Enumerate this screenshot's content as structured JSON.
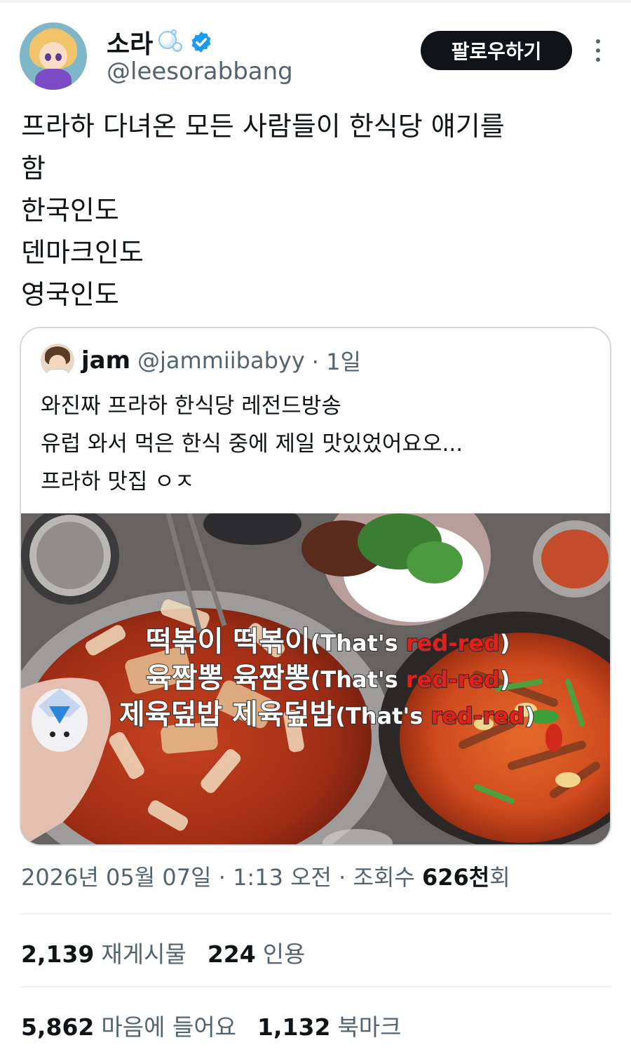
{
  "author": {
    "display_name": "소라",
    "handle": "@leesorabbang",
    "follow_label": "팔로우하기"
  },
  "tweet": {
    "lines": [
      "프라하 다녀온 모든 사람들이 한식당 얘기를",
      "함",
      "한국인도",
      "덴마크인도",
      "영국인도"
    ]
  },
  "quote": {
    "name": "jam",
    "handle": "@jammiibabyy",
    "age": "· 1일",
    "lines": [
      "와진짜 프라하 한식당 레전드방송",
      "유럽 와서 먹은 한식 중에 제일 맛있었어요오...",
      "프라하 맛집 ㅇㅈ"
    ],
    "photo_overlay": [
      {
        "ko": "떡볶이 떡볶이",
        "en": "(That's ",
        "red": "red-red",
        "end": ")"
      },
      {
        "ko": "육짬뽕 육짬뽕",
        "en": "(That's ",
        "red": "red-red",
        "end": ")"
      },
      {
        "ko": "제육덮밥 제육덮밥",
        "en": "(That's ",
        "red": "red-red",
        "end": ")"
      }
    ]
  },
  "meta": {
    "date": "2026년 05월 07일",
    "sep1": " · ",
    "time": "1:13 오전",
    "sep2": " · ",
    "views_label": "조회수 ",
    "views_value": "626천",
    "views_suffix": "회"
  },
  "stats": {
    "reposts_value": "2,139",
    "reposts_label": "재게시물",
    "quotes_value": "224",
    "quotes_label": "인용",
    "likes_value": "5,862",
    "likes_label": "마음에 들어요",
    "bookmarks_value": "1,132",
    "bookmarks_label": "북마크"
  },
  "colors": {
    "verified": "#1d9bf0",
    "follow_bg": "#0f1419",
    "overlay_red": "#e0201c"
  },
  "icons": [
    "bubble-icon",
    "verified-icon",
    "more-icon"
  ]
}
